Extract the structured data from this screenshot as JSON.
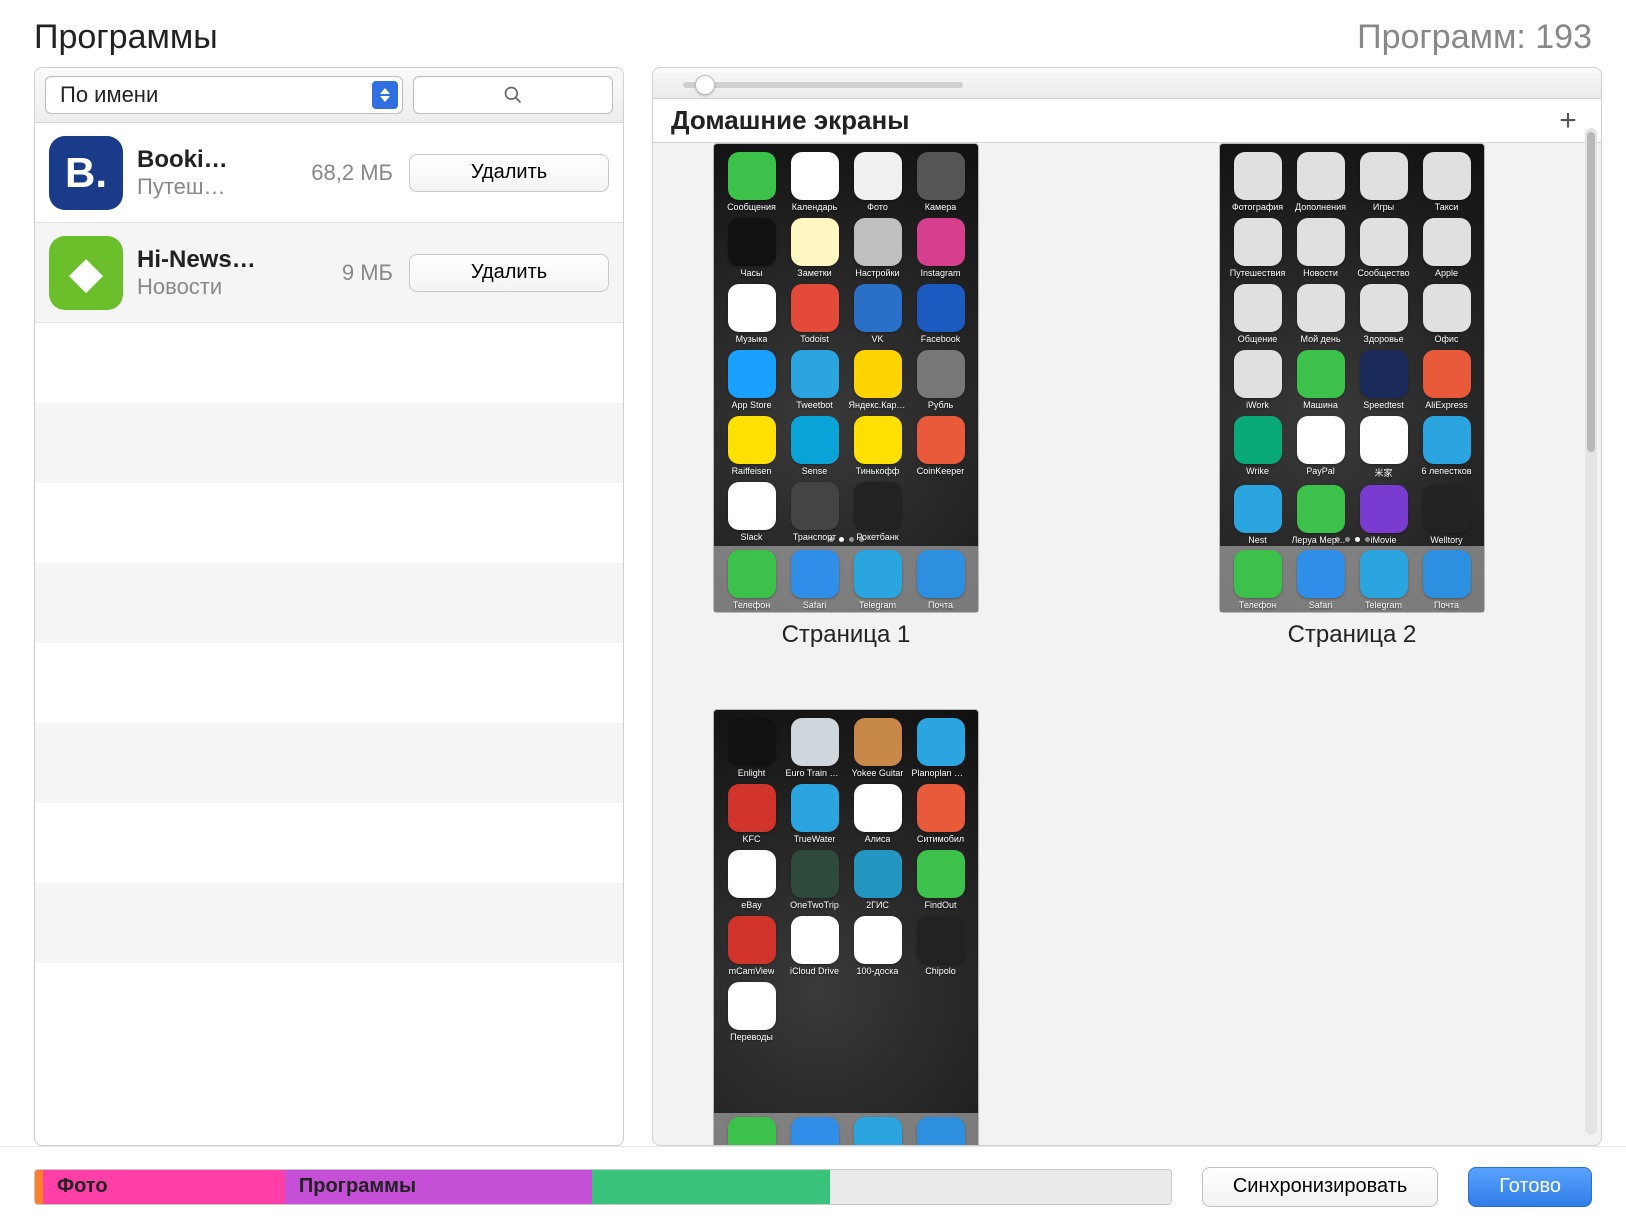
{
  "header": {
    "title": "Программы",
    "count_label": "Программ: 193"
  },
  "left": {
    "sort_label": "По имени",
    "search_placeholder": "",
    "apps": [
      {
        "name": "Booki…",
        "category": "Путеш…",
        "size": "68,2 МБ",
        "action": "Удалить",
        "icon_bg": "#1a3b8a",
        "icon_letter": "B."
      },
      {
        "name": "Hi-News…",
        "category": "Новости",
        "size": "9 МБ",
        "action": "Удалить",
        "icon_bg": "#6bbf2a",
        "icon_letter": "◆"
      }
    ]
  },
  "right": {
    "section_title": "Домашние экраны",
    "zoom_value": 8,
    "screens": [
      {
        "label": "Страница 1",
        "dock": [
          {
            "label": "Телефон",
            "bg": "#3cc24b"
          },
          {
            "label": "Safari",
            "bg": "#2f8fe8"
          },
          {
            "label": "Telegram",
            "bg": "#2aa5e0"
          },
          {
            "label": "Почта",
            "bg": "#2d8fe0"
          }
        ],
        "rows": [
          [
            {
              "label": "Сообщения",
              "bg": "#3cc24b"
            },
            {
              "label": "Календарь",
              "bg": "#ffffff"
            },
            {
              "label": "Фото",
              "bg": "#f0f0f0"
            },
            {
              "label": "Камера",
              "bg": "#555"
            }
          ],
          [
            {
              "label": "Часы",
              "bg": "#111"
            },
            {
              "label": "Заметки",
              "bg": "#fff7c2"
            },
            {
              "label": "Настройки",
              "bg": "#bfbfbf"
            },
            {
              "label": "Instagram",
              "bg": "#d63f8e"
            }
          ],
          [
            {
              "label": "Музыка",
              "bg": "#ffffff"
            },
            {
              "label": "Todoist",
              "bg": "#e34a3a"
            },
            {
              "label": "VK",
              "bg": "#2a6fc8"
            },
            {
              "label": "Facebook",
              "bg": "#1b5bbf"
            }
          ],
          [
            {
              "label": "App Store",
              "bg": "#1aa0ff"
            },
            {
              "label": "Tweetbot",
              "bg": "#2aa5e0"
            },
            {
              "label": "Яндекс.Карты",
              "bg": "#ffd400"
            },
            {
              "label": "Рубль",
              "bg": "#777"
            }
          ],
          [
            {
              "label": "Raiffeisen",
              "bg": "#ffe000"
            },
            {
              "label": "Sense",
              "bg": "#0aa3d8"
            },
            {
              "label": "Тинькофф",
              "bg": "#ffe000"
            },
            {
              "label": "CoinKeeper",
              "bg": "#e85a3a"
            }
          ],
          [
            {
              "label": "Slack",
              "bg": "#fff"
            },
            {
              "label": "Транспорт",
              "bg": "#444"
            },
            {
              "label": "Рокетбанк",
              "bg": "#222"
            },
            {
              "label": "",
              "bg": ""
            }
          ]
        ]
      },
      {
        "label": "Страница 2",
        "dock": [
          {
            "label": "Телефон",
            "bg": "#3cc24b"
          },
          {
            "label": "Safari",
            "bg": "#2f8fe8"
          },
          {
            "label": "Telegram",
            "bg": "#2aa5e0"
          },
          {
            "label": "Почта",
            "bg": "#2d8fe0"
          }
        ],
        "rows": [
          [
            {
              "label": "Фотография",
              "bg": "#e0e0e0"
            },
            {
              "label": "Дополнения",
              "bg": "#e0e0e0"
            },
            {
              "label": "Игры",
              "bg": "#e0e0e0"
            },
            {
              "label": "Такси",
              "bg": "#e0e0e0"
            }
          ],
          [
            {
              "label": "Путешествия",
              "bg": "#e0e0e0"
            },
            {
              "label": "Новости",
              "bg": "#e0e0e0"
            },
            {
              "label": "Сообщество",
              "bg": "#e0e0e0"
            },
            {
              "label": "Apple",
              "bg": "#e0e0e0"
            }
          ],
          [
            {
              "label": "Общение",
              "bg": "#e0e0e0"
            },
            {
              "label": "Мой день",
              "bg": "#e0e0e0"
            },
            {
              "label": "Здоровье",
              "bg": "#e0e0e0"
            },
            {
              "label": "Офис",
              "bg": "#e0e0e0"
            }
          ],
          [
            {
              "label": "iWork",
              "bg": "#e0e0e0"
            },
            {
              "label": "Машина",
              "bg": "#3cc24b"
            },
            {
              "label": "Speedtest",
              "bg": "#1a2a5a"
            },
            {
              "label": "AliExpress",
              "bg": "#e85a3a"
            }
          ],
          [
            {
              "label": "Wrike",
              "bg": "#0aa978"
            },
            {
              "label": "PayPal",
              "bg": "#fff"
            },
            {
              "label": "米家",
              "bg": "#fff"
            },
            {
              "label": "6 лепестков",
              "bg": "#2aa5e0"
            }
          ],
          [
            {
              "label": "Nest",
              "bg": "#2aa5e0"
            },
            {
              "label": "Леруа Мерлен",
              "bg": "#3cc24b"
            },
            {
              "label": "iMovie",
              "bg": "#7a3bd0"
            },
            {
              "label": "Welltory",
              "bg": "#222"
            }
          ]
        ]
      },
      {
        "label": "",
        "cut": true,
        "dock": [
          {
            "label": "",
            "bg": "#3cc24b"
          },
          {
            "label": "",
            "bg": "#2f8fe8"
          },
          {
            "label": "",
            "bg": "#2aa5e0"
          },
          {
            "label": "",
            "bg": "#2d8fe0"
          }
        ],
        "rows": [
          [
            {
              "label": "Enlight",
              "bg": "#111"
            },
            {
              "label": "Euro Train Sim",
              "bg": "#cfd6dc"
            },
            {
              "label": "Yokee Guitar",
              "bg": "#c8884a"
            },
            {
              "label": "Planoplan GO!",
              "bg": "#2aa5e0"
            }
          ],
          [
            {
              "label": "KFC",
              "bg": "#d1342a"
            },
            {
              "label": "TrueWater",
              "bg": "#2aa5e0"
            },
            {
              "label": "Алиса",
              "bg": "#fff"
            },
            {
              "label": "Ситимобил",
              "bg": "#e85a3a"
            }
          ],
          [
            {
              "label": "eBay",
              "bg": "#fff"
            },
            {
              "label": "OneTwoTrip",
              "bg": "#2d4a3a"
            },
            {
              "label": "2ГИС",
              "bg": "#2296c0"
            },
            {
              "label": "FindOut",
              "bg": "#3cc24b"
            }
          ],
          [
            {
              "label": "mCamView",
              "bg": "#d1342a"
            },
            {
              "label": "iCloud Drive",
              "bg": "#fff"
            },
            {
              "label": "100-доска",
              "bg": "#fff"
            },
            {
              "label": "Chipolo",
              "bg": "#222"
            }
          ],
          [
            {
              "label": "Переводы",
              "bg": "#fff"
            },
            {
              "label": "",
              "bg": ""
            },
            {
              "label": "",
              "bg": ""
            },
            {
              "label": "",
              "bg": ""
            }
          ]
        ]
      }
    ]
  },
  "footer": {
    "segments": [
      {
        "label": "Фото",
        "bg": "#ff3fa8",
        "width": "22%",
        "accent": "#ff7f2a"
      },
      {
        "label": "Программы",
        "bg": "#c64fd8",
        "width": "27%"
      },
      {
        "label": "",
        "bg": "#39c27a",
        "width": "21%"
      },
      {
        "label": "",
        "bg": "#eaeaea",
        "width": "30%"
      }
    ],
    "sync_label": "Синхронизировать",
    "done_label": "Готово"
  }
}
